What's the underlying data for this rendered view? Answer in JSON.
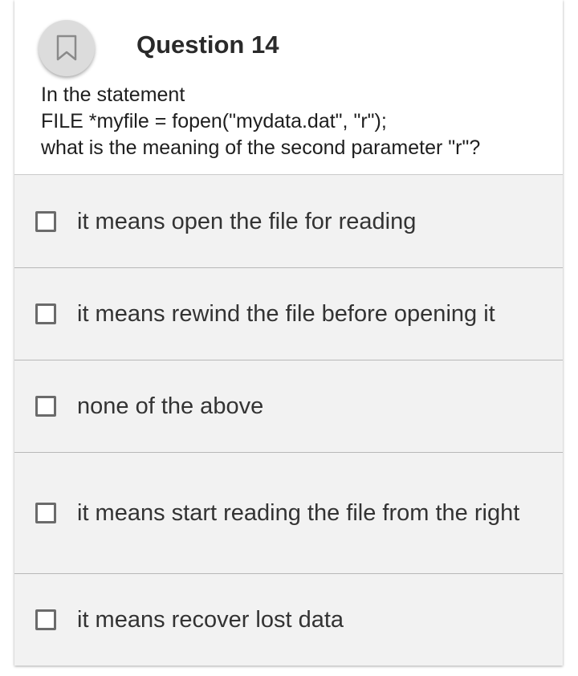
{
  "question": {
    "title": "Question 14",
    "text_lines": [
      "In the statement",
      "FILE *myfile = fopen(\"mydata.dat\", \"r\");",
      "what is the meaning of the second parameter \"r\"?"
    ],
    "bookmark_icon": "bookmark-icon"
  },
  "options": [
    {
      "label": "it means open the file for reading",
      "checked": false
    },
    {
      "label": "it means rewind the file before opening it",
      "checked": false
    },
    {
      "label": "none of the above",
      "checked": false
    },
    {
      "label": "it means start reading the file from the right",
      "checked": false
    },
    {
      "label": "it means recover lost data",
      "checked": false
    }
  ],
  "colors": {
    "card_background": "#f2f2f2",
    "header_background": "#ffffff",
    "checkbox_border": "#6b6b6b",
    "divider": "#b8b8b8"
  }
}
